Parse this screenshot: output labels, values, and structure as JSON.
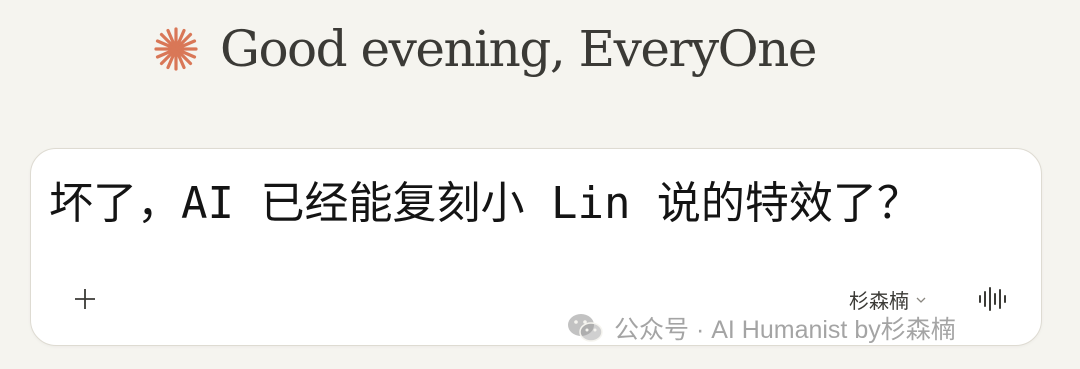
{
  "greeting": {
    "text": "Good evening, EveryOne",
    "icon": "spark-icon",
    "icon_color": "#d97757"
  },
  "input_box": {
    "text": "坏了，AI 已经能复刻小 Lin 说的特效了？",
    "add_button_label": "+",
    "model_label": "杉森楠",
    "voice_icon": "voice-waveform-icon"
  },
  "watermark": {
    "text": "公众号 · AI Humanist by杉森楠",
    "icon": "wechat-icon"
  }
}
